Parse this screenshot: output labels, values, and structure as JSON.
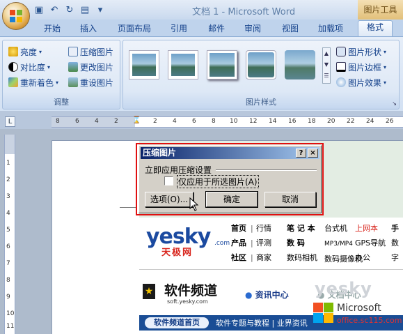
{
  "window": {
    "app_title": "文档 1 - Microsoft Word",
    "context_tab_title": "图片工具"
  },
  "quick_access": [
    "save-icon",
    "undo-icon",
    "redo-icon",
    "print-icon",
    "customize-icon"
  ],
  "tabs": [
    {
      "label": "开始"
    },
    {
      "label": "插入"
    },
    {
      "label": "页面布局"
    },
    {
      "label": "引用"
    },
    {
      "label": "邮件"
    },
    {
      "label": "审阅"
    },
    {
      "label": "视图"
    },
    {
      "label": "加载项"
    },
    {
      "label": "格式",
      "active": true
    }
  ],
  "ribbon": {
    "adjust": {
      "label": "调整",
      "brightness": "亮度",
      "contrast": "对比度",
      "recolor": "重新着色",
      "compress": "压缩图片",
      "change_picture": "更改图片",
      "reset_picture": "重设图片"
    },
    "styles": {
      "label": "图片样式",
      "shape": "图片形状",
      "border": "图片边框",
      "effects": "图片效果"
    }
  },
  "ruler": {
    "h_ticks": [
      "8",
      "6",
      "4",
      "2",
      "2",
      "4",
      "6",
      "8",
      "10",
      "12",
      "14",
      "16",
      "18",
      "20",
      "22",
      "24",
      "26"
    ],
    "v_ticks": [
      "1",
      "2",
      "3",
      "4",
      "5",
      "6",
      "7",
      "8",
      "9",
      "10",
      "11"
    ]
  },
  "dialog": {
    "title": "压缩图片",
    "help_btn": "?",
    "close_btn": "×",
    "section": "立即应用压缩设置",
    "checkbox_label": "仅应用于所选图片(A)",
    "options_btn": "选项(O)...",
    "ok_btn": "确定",
    "cancel_btn": "取消"
  },
  "web": {
    "logo": "yesky",
    "logo_com": ".com",
    "logo_cn": "天极网",
    "nav_col1": [
      "首页",
      "产品",
      "社区"
    ],
    "nav_col2": [
      "行情",
      "评测",
      "商家"
    ],
    "nav_col3a": [
      "笔 记 本",
      "数    码",
      "数码相机"
    ],
    "nav_col3b": [
      "台式机",
      "MP3/MP4",
      "数码摄像机"
    ],
    "nav_col4": [
      "上网本",
      "GPS导航",
      "办公"
    ],
    "nav_col5": [
      "手",
      "数字",
      ""
    ],
    "soft_title": "软件频道",
    "soft_url": "soft.yesky.com",
    "mini_nav1": "资讯中心",
    "mini_nav2": "文档中心",
    "home_tab": "软件频道首页",
    "bottom_links": "软件专题与教程 | 业界资讯"
  },
  "watermark": {
    "line1": "Microsoft",
    "line2": "office.sc115.com",
    "yesky": "yesky"
  },
  "colors": {
    "dialog_title_start": "#0a246a",
    "dialog_title_end": "#a6caf0",
    "highlight": "#e01010",
    "nav_hot": "#d8241c"
  }
}
